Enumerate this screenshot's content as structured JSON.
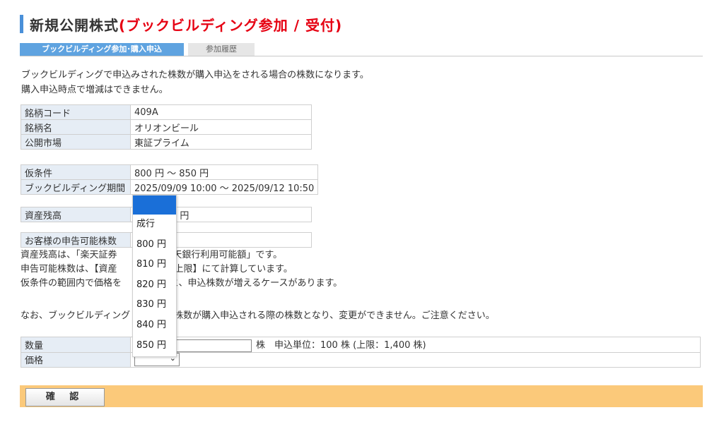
{
  "header": {
    "title_main": "新規公開株式",
    "title_sub": "(ブックビルディング参加 / 受付)"
  },
  "tabs": [
    {
      "label": "ブックビルディング参加･購入申込"
    },
    {
      "label": "参加履歴"
    }
  ],
  "intro": {
    "line1": "ブックビルディングで申込みされた株数が購入申込をされる場合の株数になります。",
    "line2": "購入申込時点で増減はできません。"
  },
  "stock_info": {
    "code_label": "銘柄コード",
    "code_value": "409A",
    "name_label": "銘柄名",
    "name_value": "オリオンビール",
    "market_label": "公開市場",
    "market_value": "東証プライム"
  },
  "condition": {
    "price_label": "仮条件",
    "price_value": "800 円 〜 850 円",
    "period_label": "ブックビルディング期間",
    "period_value": "2025/09/09 10:00 〜 2025/09/12 10:50"
  },
  "balance": {
    "label": "資産残高",
    "value_tail": "9 円"
  },
  "declarable": {
    "label": "お客様の申告可能株数"
  },
  "notes": {
    "line1_a": "資産残高は、「楽天証券",
    "line1_b": "+「楽天銀行利用可能額」です。",
    "line2_a": "申告可能株数は、【資産",
    "line2_b": "条件の上限】にて計算しています。",
    "line3_a": "仮条件の範囲内で価格を",
    "line3_b": "ますと、申込株数が増えるケースがあります。"
  },
  "caution": {
    "part_a": "なお、ブックビルディング",
    "part_b": "株数が購入申込される際の株数となり、変更ができません。ご注意ください。"
  },
  "order": {
    "qty_label": "数量",
    "qty_suffix": "株　申込単位：100 株 (上限：1,400 株)",
    "price_label": "価格",
    "price_chevron": "⌄"
  },
  "price_options": [
    "成行",
    "800 円",
    "810 円",
    "820 円",
    "830 円",
    "840 円",
    "850 円"
  ],
  "actions": {
    "confirm_label": "確 認"
  }
}
